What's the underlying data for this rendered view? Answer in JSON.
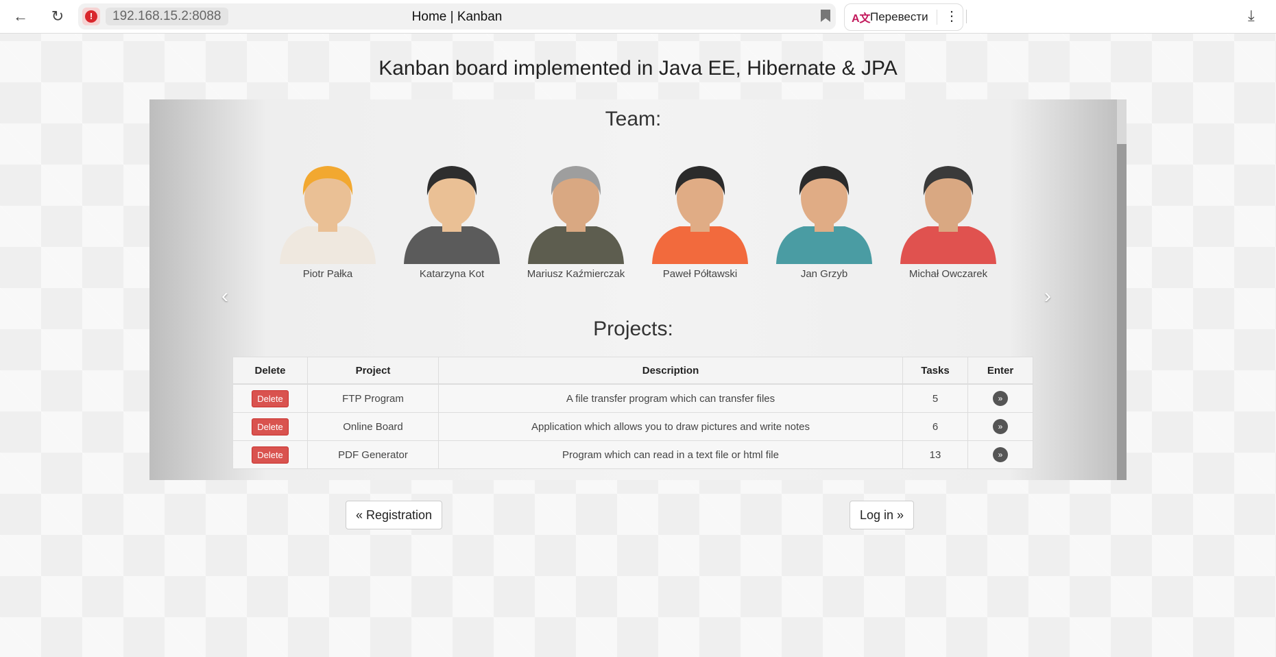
{
  "browser": {
    "url": "192.168.15.2:8088",
    "tab_title": "Home | Kanban",
    "translate_label": "Перевести",
    "icons": [
      "back-arrow-icon",
      "reload-icon",
      "warning-icon",
      "bookmark-icon",
      "translate-icon",
      "more-icon",
      "download-icon"
    ]
  },
  "page": {
    "title": "Kanban board implemented in Java EE, Hibernate & JPA"
  },
  "team": {
    "heading": "Team:",
    "members": [
      {
        "name": "Piotr Pałka",
        "hair": "#f2a830",
        "shirt": "#efe8df",
        "skin": "#eac095"
      },
      {
        "name": "Katarzyna Kot",
        "hair": "#2e2e2e",
        "shirt": "#5b5b5b",
        "skin": "#eac095"
      },
      {
        "name": "Mariusz Kaźmierczak",
        "hair": "#9e9e9e",
        "shirt": "#5d5d4f",
        "skin": "#d9a882"
      },
      {
        "name": "Paweł Półtawski",
        "hair": "#2b2b2b",
        "shirt": "#f26a3d",
        "skin": "#e0ac85"
      },
      {
        "name": "Jan Grzyb",
        "hair": "#2b2b2b",
        "shirt": "#4a9ca3",
        "skin": "#e0ac85"
      },
      {
        "name": "Michał Owczarek",
        "hair": "#3a3a3a",
        "shirt": "#e0524f",
        "skin": "#d9a882"
      }
    ],
    "prev_arrow": "‹",
    "next_arrow": "›"
  },
  "projects": {
    "heading": "Projects:",
    "columns": [
      "Delete",
      "Project",
      "Description",
      "Tasks",
      "Enter"
    ],
    "rows": [
      {
        "delete_label": "Delete",
        "project": "FTP Program",
        "description": "A file transfer program which can transfer files",
        "tasks": "5",
        "enter": "»"
      },
      {
        "delete_label": "Delete",
        "project": "Online Board",
        "description": "Application which allows you to draw pictures and write notes",
        "tasks": "6",
        "enter": "»"
      },
      {
        "delete_label": "Delete",
        "project": "PDF Generator",
        "description": "Program which can read in a text file or html file",
        "tasks": "13",
        "enter": "»"
      }
    ]
  },
  "pager": {
    "previous": "« Registration",
    "next": "Log in »"
  },
  "colors": {
    "delete_button": "#d9534f",
    "enter_button": "#555555"
  }
}
